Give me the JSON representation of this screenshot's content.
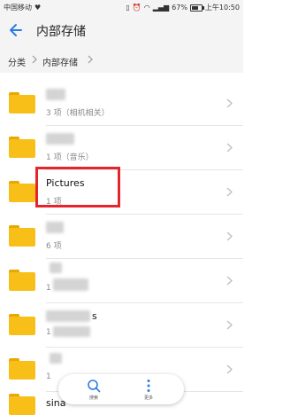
{
  "status_bar": {
    "carrier": "中国移动",
    "battery": "67%",
    "battery_fraction": 0.67,
    "time": "上午10:50"
  },
  "header": {
    "title": "内部存储"
  },
  "breadcrumb": {
    "items": [
      "分类",
      "内部存储"
    ]
  },
  "folders": [
    {
      "name": "",
      "sub": "3 项（相机相关）"
    },
    {
      "name": "",
      "sub": "1 项（音乐）"
    },
    {
      "name": "Pictures",
      "sub": "1 项"
    },
    {
      "name": "",
      "sub": "6 项"
    },
    {
      "name": "",
      "sub": "1"
    },
    {
      "name": "s",
      "sub": "1"
    },
    {
      "name": "",
      "sub": "1"
    }
  ],
  "partial_row": {
    "name": "sina"
  },
  "bottom_bar": {
    "search_label": "搜索",
    "more_label": "更多"
  },
  "colors": {
    "accent": "#2b7de3",
    "folder": "#f7bf18",
    "highlight": "#e4262c"
  },
  "icons": [
    "back-arrow-icon",
    "folder-icon",
    "chevron-right-icon",
    "search-icon",
    "more-vertical-icon"
  ]
}
